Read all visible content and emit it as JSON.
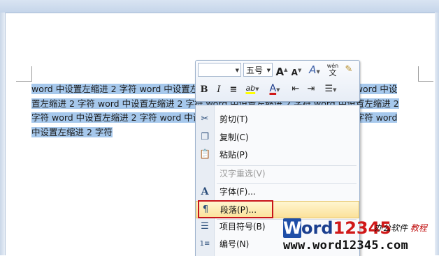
{
  "document": {
    "lines": [
      "word 中设置左缩进 2 字符 word 中设置左缩进 2 字符 word 中设置左缩进 2 字符 word 中设",
      "置左缩进 2 字符 word 中设置左缩进 2 字符 word 中设置左缩进 2 字符 word 中设置左缩进 2",
      "字符 word 中设置左缩进 2 字符 word 中设置左缩进 2 字符 word 中设置左缩进 2 字符 word",
      "中设置左缩进 2 字符"
    ]
  },
  "mini_toolbar": {
    "font_name": "",
    "font_size": "五号",
    "grow_font": "A",
    "shrink_font": "A",
    "styles_icon": "A",
    "phonetic_text": "wén",
    "phonetic_char": "文",
    "bold": "B",
    "italic": "I",
    "center": "≡",
    "highlight": "ab",
    "font_color": "A"
  },
  "menu": {
    "items": [
      {
        "icon": "scissors-icon",
        "label": "剪切(T)",
        "enabled": true
      },
      {
        "icon": "copy-icon",
        "label": "复制(C)",
        "enabled": true
      },
      {
        "icon": "paste-icon",
        "label": "粘贴(P)",
        "enabled": true
      },
      {
        "icon": "none",
        "label": "汉字重选(V)",
        "enabled": false
      },
      {
        "icon": "font-icon",
        "label": "字体(F)...",
        "enabled": true
      },
      {
        "icon": "paragraph-icon",
        "label": "段落(P)...",
        "enabled": true,
        "highlighted": true
      },
      {
        "icon": "bullets-icon",
        "label": "项目符号(B)",
        "enabled": true
      },
      {
        "icon": "numbering-icon",
        "label": "编号(N)",
        "enabled": true
      }
    ]
  },
  "watermark": {
    "w": "W",
    "brand_a": "ord",
    "brand_b": "12345",
    "tag_a": "办公软件",
    "tag_b": "教程",
    "url": "www.word12345.com"
  },
  "colors": {
    "selection": "#a6c8ec",
    "menu_highlight": "#fbe19a",
    "red_box": "#c8141a",
    "font_color_bar": "#d11919",
    "highlight_bar": "#ffff00"
  }
}
